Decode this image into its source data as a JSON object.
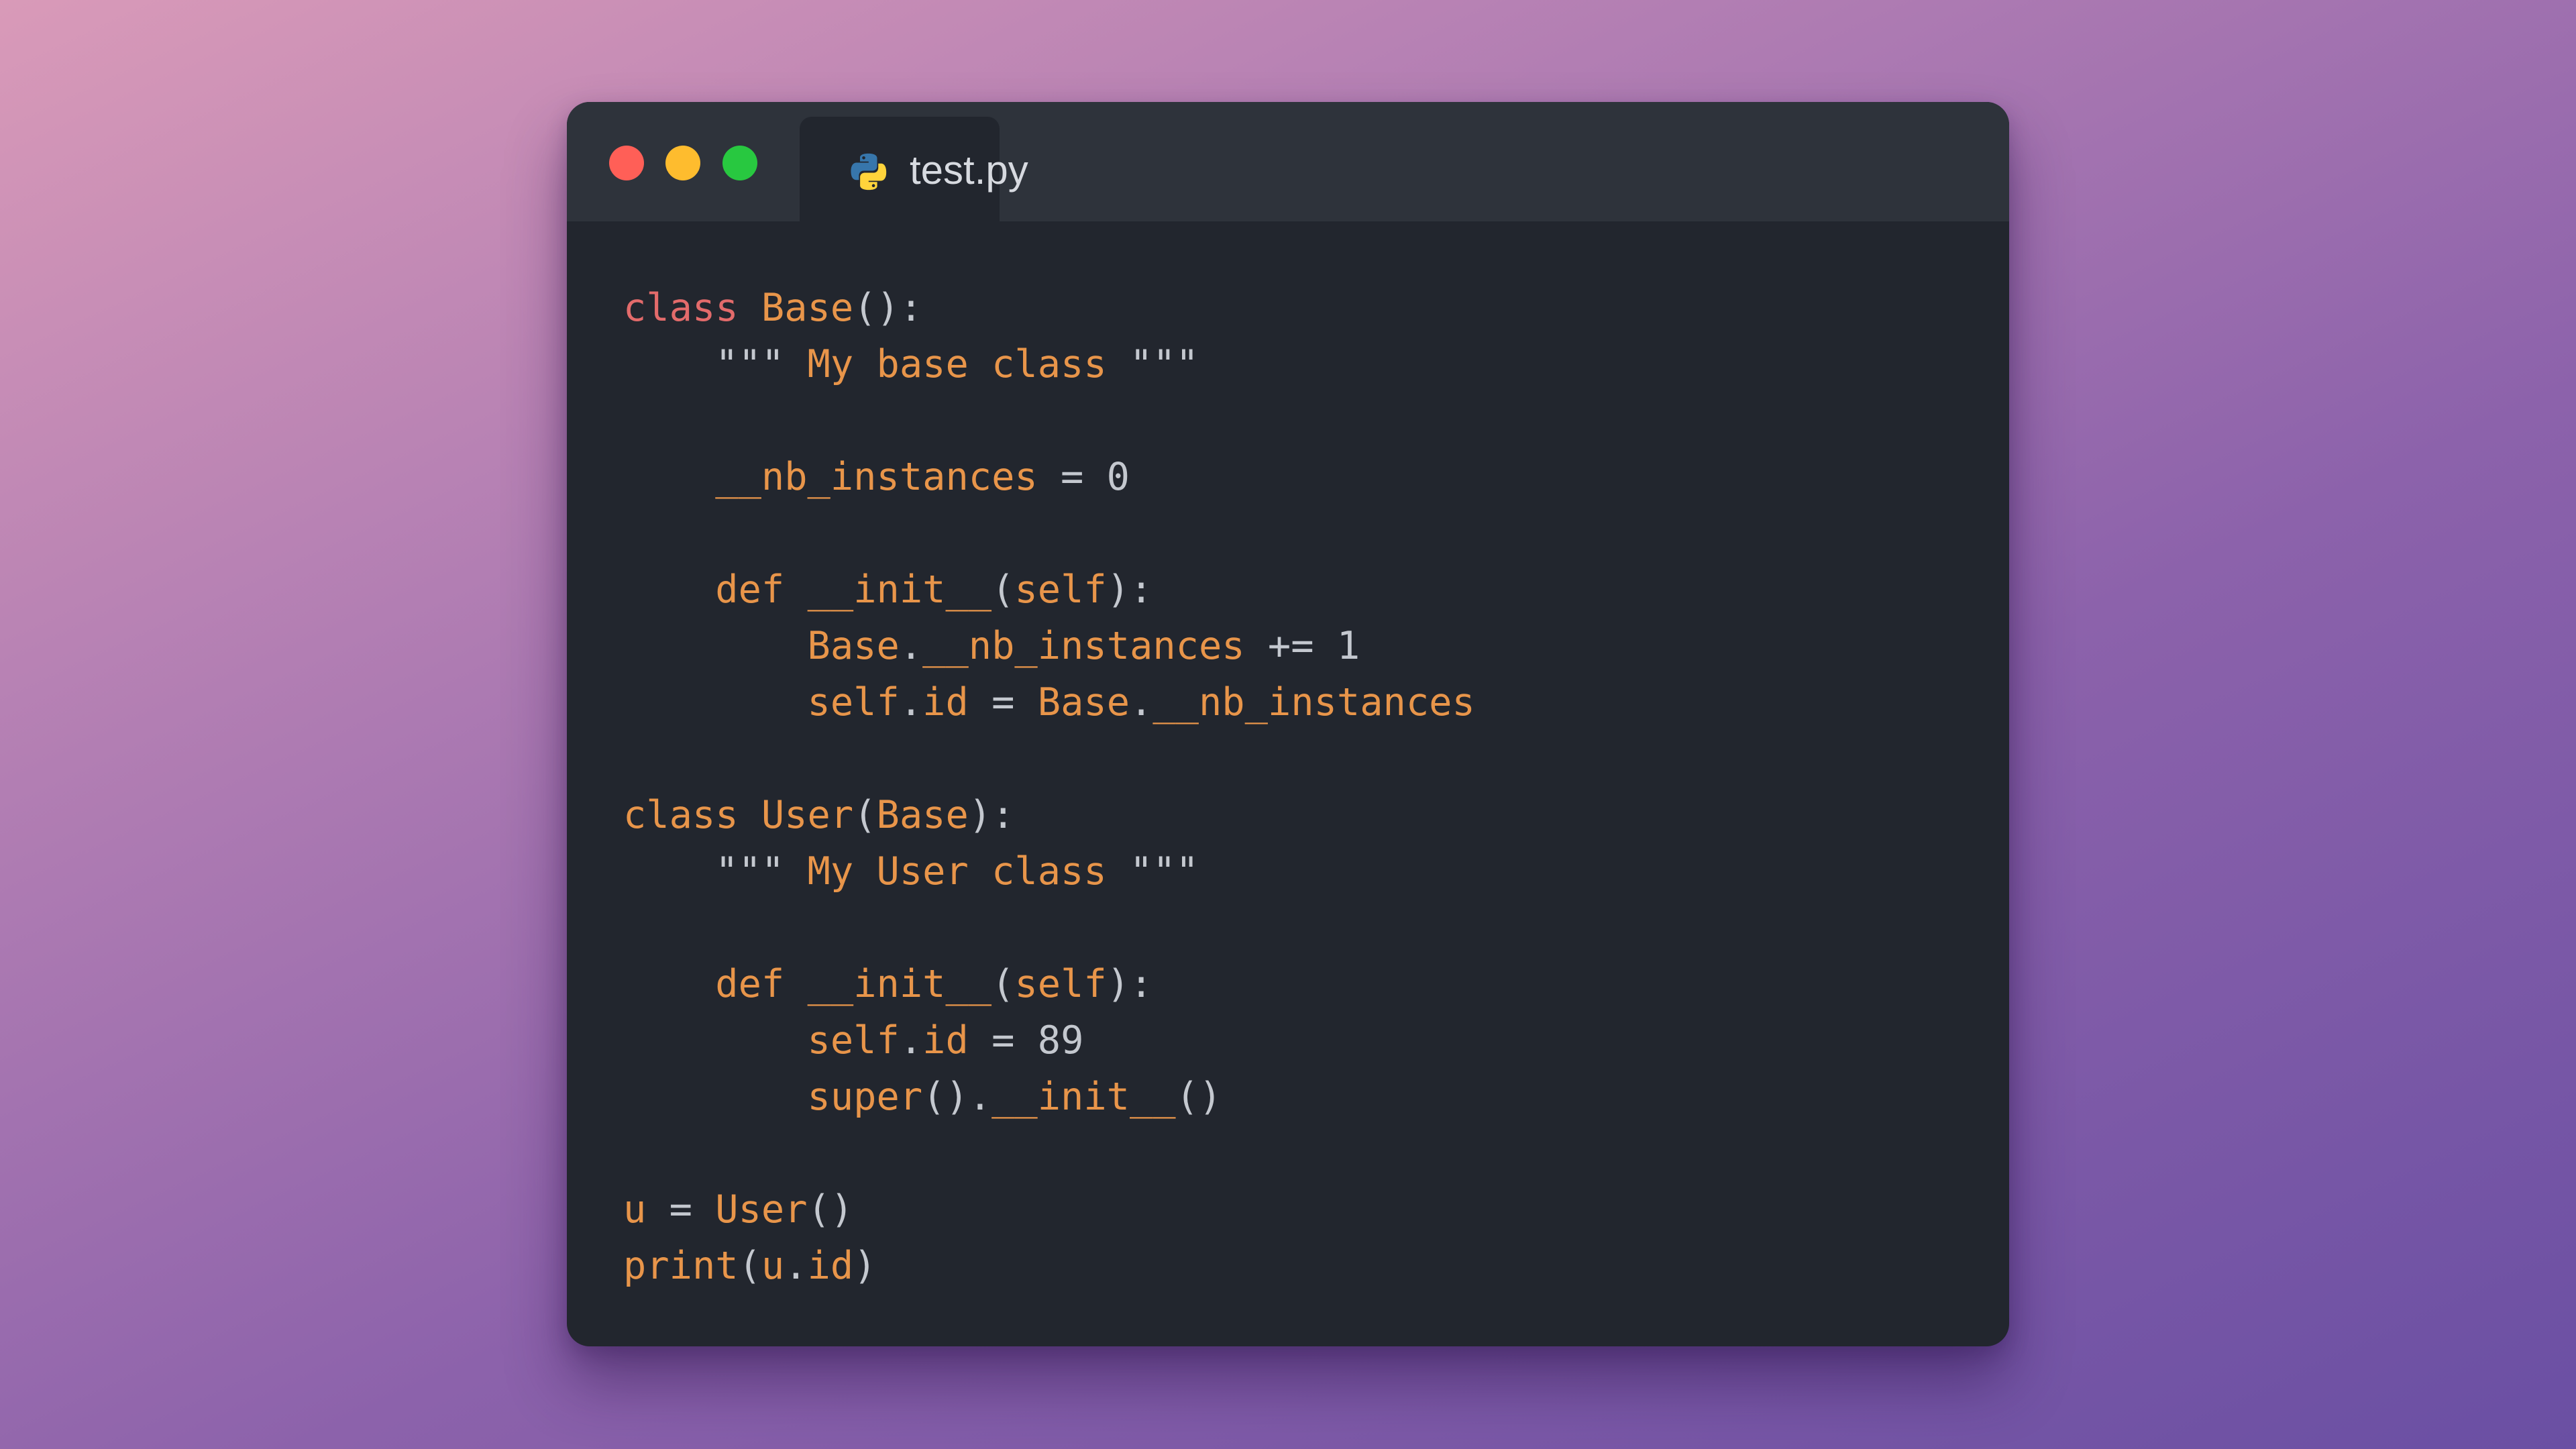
{
  "window": {
    "tab_title": "test.py",
    "tab_icon": "python-icon",
    "traffic_lights": [
      {
        "name": "close",
        "color": "#ff5f57"
      },
      {
        "name": "minimize",
        "color": "#febc2e"
      },
      {
        "name": "maximize",
        "color": "#28c840"
      }
    ]
  },
  "colors": {
    "background_gradient": [
      "#d99ab8",
      "#6a4fa3"
    ],
    "editor_bg": "#22262e",
    "titlebar_bg": "#2e333b",
    "keyword_class": "#e36b6b",
    "identifier": "#e8954a",
    "punctuation": "#c4c8cf"
  },
  "code": {
    "language": "python",
    "lines": [
      [
        [
          "kw-class",
          "class"
        ],
        [
          "plain",
          " "
        ],
        [
          "name",
          "Base"
        ],
        [
          "punc",
          "():"
        ]
      ],
      [
        [
          "plain",
          "    "
        ],
        [
          "quote",
          "\"\"\""
        ],
        [
          "str",
          " My base class "
        ],
        [
          "quote",
          "\"\"\""
        ]
      ],
      [],
      [
        [
          "plain",
          "    "
        ],
        [
          "name",
          "__nb_instances"
        ],
        [
          "op",
          " = "
        ],
        [
          "num",
          "0"
        ]
      ],
      [],
      [
        [
          "plain",
          "    "
        ],
        [
          "kw",
          "def"
        ],
        [
          "plain",
          " "
        ],
        [
          "name",
          "__init__"
        ],
        [
          "punc",
          "("
        ],
        [
          "name",
          "self"
        ],
        [
          "punc",
          "):"
        ]
      ],
      [
        [
          "plain",
          "        "
        ],
        [
          "name",
          "Base"
        ],
        [
          "punc",
          "."
        ],
        [
          "name",
          "__nb_instances"
        ],
        [
          "op",
          " += "
        ],
        [
          "num",
          "1"
        ]
      ],
      [
        [
          "plain",
          "        "
        ],
        [
          "name",
          "self"
        ],
        [
          "punc",
          "."
        ],
        [
          "name",
          "id"
        ],
        [
          "op",
          " = "
        ],
        [
          "name",
          "Base"
        ],
        [
          "punc",
          "."
        ],
        [
          "name",
          "__nb_instances"
        ]
      ],
      [],
      [
        [
          "kw",
          "class"
        ],
        [
          "plain",
          " "
        ],
        [
          "name",
          "User"
        ],
        [
          "punc",
          "("
        ],
        [
          "name",
          "Base"
        ],
        [
          "punc",
          "):"
        ]
      ],
      [
        [
          "plain",
          "    "
        ],
        [
          "quote",
          "\"\"\""
        ],
        [
          "str",
          " My User class "
        ],
        [
          "quote",
          "\"\"\""
        ]
      ],
      [],
      [
        [
          "plain",
          "    "
        ],
        [
          "kw",
          "def"
        ],
        [
          "plain",
          " "
        ],
        [
          "name",
          "__init__"
        ],
        [
          "punc",
          "("
        ],
        [
          "name",
          "self"
        ],
        [
          "punc",
          "):"
        ]
      ],
      [
        [
          "plain",
          "        "
        ],
        [
          "name",
          "self"
        ],
        [
          "punc",
          "."
        ],
        [
          "name",
          "id"
        ],
        [
          "op",
          " = "
        ],
        [
          "num",
          "89"
        ]
      ],
      [
        [
          "plain",
          "        "
        ],
        [
          "name",
          "super"
        ],
        [
          "punc",
          "()."
        ],
        [
          "name",
          "__init__"
        ],
        [
          "punc",
          "()"
        ]
      ],
      [],
      [
        [
          "name",
          "u"
        ],
        [
          "op",
          " = "
        ],
        [
          "name",
          "User"
        ],
        [
          "punc",
          "()"
        ]
      ],
      [
        [
          "name",
          "print"
        ],
        [
          "punc",
          "("
        ],
        [
          "name",
          "u"
        ],
        [
          "punc",
          "."
        ],
        [
          "name",
          "id"
        ],
        [
          "punc",
          ")"
        ]
      ]
    ]
  }
}
